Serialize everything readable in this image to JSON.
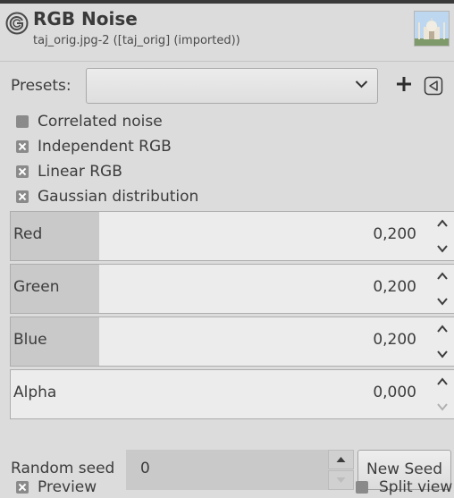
{
  "header": {
    "title": "RGB Noise",
    "subtitle": "taj_orig.jpg-2 ([taj_orig] (imported))",
    "icon": "gimp-logo-icon",
    "thumbnail": "image-thumbnail"
  },
  "presets": {
    "label": "Presets:",
    "value": "",
    "add_icon": "plus-icon",
    "collapse_icon": "triangle-left-icon"
  },
  "checkboxes": [
    {
      "label": "Correlated noise",
      "checked": false
    },
    {
      "label": "Independent RGB",
      "checked": true
    },
    {
      "label": "Linear RGB",
      "checked": true
    },
    {
      "label": "Gaussian distribution",
      "checked": true
    }
  ],
  "scales": [
    {
      "label": "Red",
      "value": "0,200",
      "fraction": 0.2
    },
    {
      "label": "Green",
      "value": "0,200",
      "fraction": 0.2
    },
    {
      "label": "Blue",
      "value": "0,200",
      "fraction": 0.2
    },
    {
      "label": "Alpha",
      "value": "0,000",
      "fraction": 0.0
    }
  ],
  "seed": {
    "label": "Random seed",
    "value": "0",
    "button": "New Seed"
  },
  "bottom": {
    "preview_label": "Preview",
    "preview_checked": true,
    "split_label": "Split view",
    "split_checked": false
  },
  "colors": {
    "background": "#dcdcdc",
    "checkbox": "#8a8a8a",
    "scale_fill": "#c9c9c9"
  }
}
